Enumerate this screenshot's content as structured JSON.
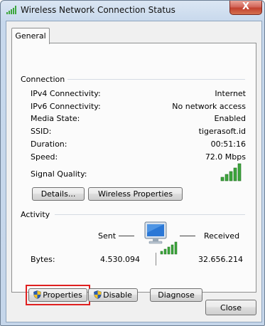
{
  "window": {
    "title": "Wireless Network Connection Status",
    "close_glyph": "X"
  },
  "tabs": [
    {
      "label": "General"
    }
  ],
  "connection": {
    "section_label": "Connection",
    "rows": [
      {
        "label": "IPv4 Connectivity:",
        "value": "Internet"
      },
      {
        "label": "IPv6 Connectivity:",
        "value": "No network access"
      },
      {
        "label": "Media State:",
        "value": "Enabled"
      },
      {
        "label": "SSID:",
        "value": "tigerasoft.id"
      },
      {
        "label": "Duration:",
        "value": "00:51:16"
      },
      {
        "label": "Speed:",
        "value": "72.0 Mbps"
      }
    ],
    "signal_quality_label": "Signal Quality:",
    "signal_quality_bars": 5,
    "details_button": "Details...",
    "wireless_properties_button": "Wireless Properties"
  },
  "activity": {
    "section_label": "Activity",
    "sent_label": "Sent",
    "received_label": "Received",
    "bytes_label": "Bytes:",
    "bytes_sent": "4.530.094",
    "bytes_received": "32.656.214"
  },
  "actions": {
    "properties": "Properties",
    "disable": "Disable",
    "diagnose": "Diagnose"
  },
  "footer": {
    "close": "Close"
  },
  "colors": {
    "signal_green": "#3da63d",
    "highlight_red": "#e02020",
    "uac_shield_blue": "#2b5fb4",
    "uac_shield_yellow": "#f2c224"
  }
}
